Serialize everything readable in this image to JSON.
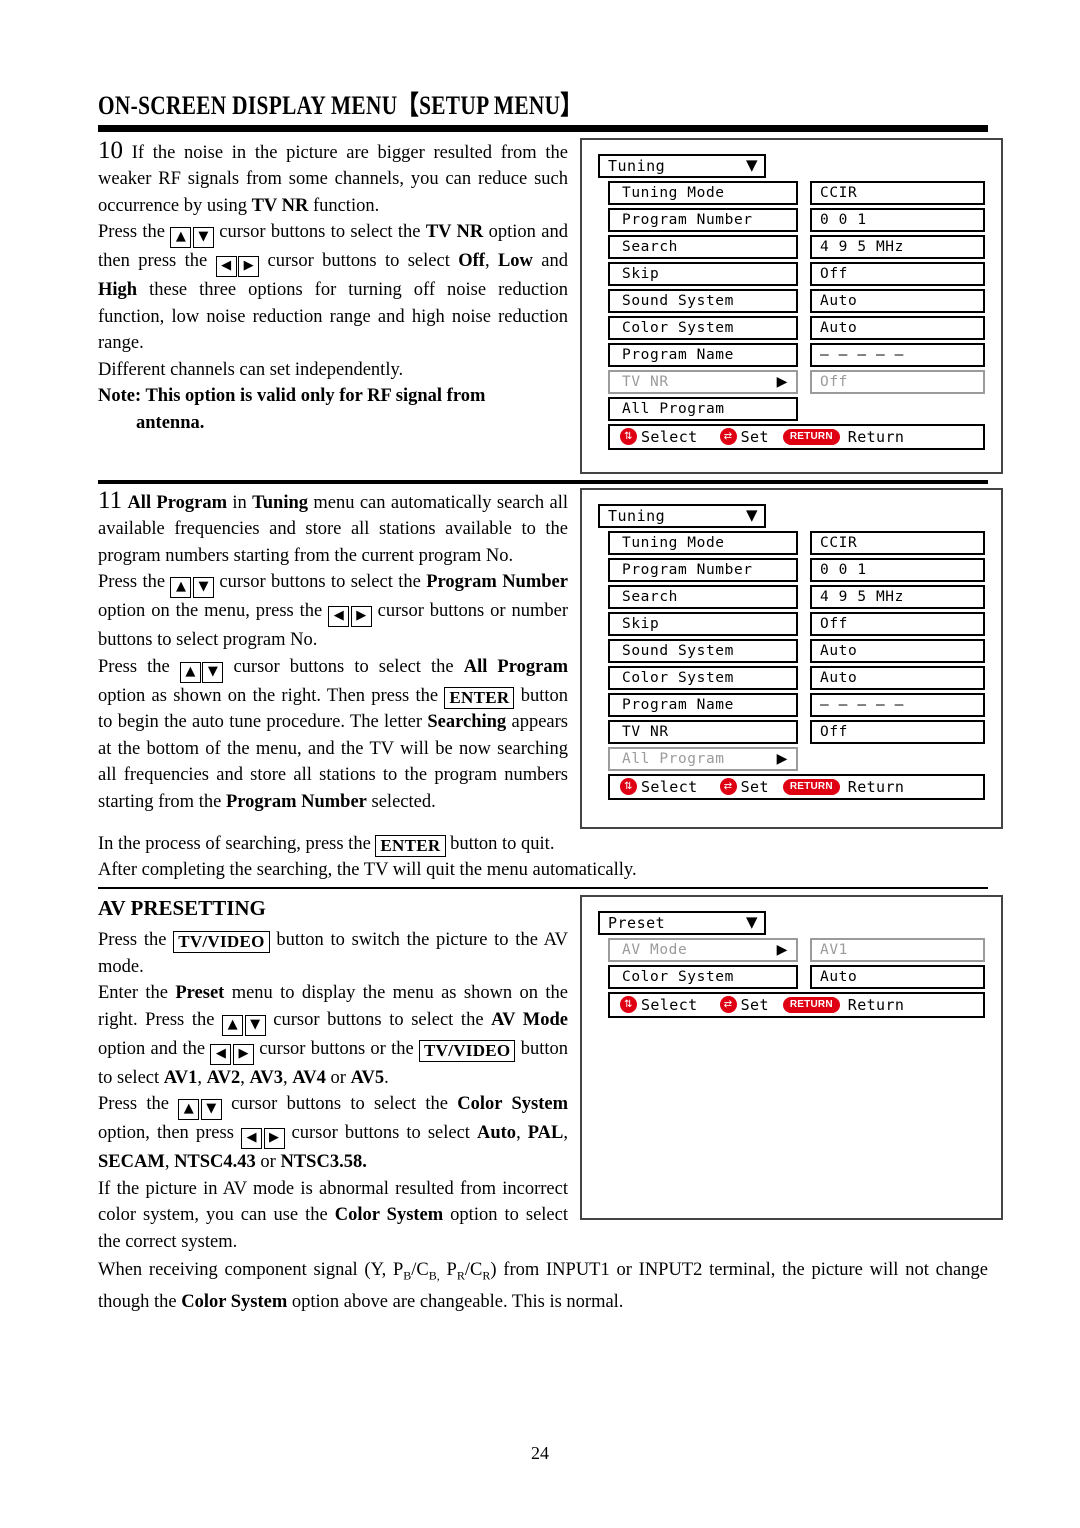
{
  "header": {
    "title": "ON-SCREEN DISPLAY MENU【SETUP MENU】"
  },
  "sections": {
    "item10": {
      "number": "10",
      "p1_a": "If the noise in the picture are bigger resulted from the weaker RF signals from some channels, you can reduce such occurrence by using ",
      "p1_b": "TV NR",
      "p1_c": " function.",
      "p2_a": "Press the ",
      "p2_b": " cursor buttons to select the ",
      "p2_c": "TV NR",
      "p2_d": " option and then press the ",
      "p2_e": " cursor buttons to select ",
      "p2_f": "Off",
      "p2_g": ", ",
      "p2_h": "Low",
      "p2_i": " and ",
      "p2_j": "High",
      "p2_k": " these three options for turning off noise reduction function, low noise reduction range and high noise reduction range.",
      "p3": "Different channels can set independently.",
      "note_label": "Note:",
      "note_body": " This option is valid only for RF signal from",
      "note_indent": "antenna."
    },
    "item11": {
      "number": "11",
      "p1_a": "All Program",
      "p1_b": " in ",
      "p1_c": "Tuning",
      "p1_d": " menu can automatically search all available frequencies and store all stations available to the program numbers starting from the current program No.",
      "p2_a": "Press the ",
      "p2_b": " cursor buttons to select the ",
      "p2_c": "Program Number",
      "p2_d": " option on the menu, press the ",
      "p2_e": " cursor buttons or number buttons to select program No.",
      "p3_a": "Press the ",
      "p3_b": " cursor buttons to select the ",
      "p3_c": "All Program",
      "p3_d": " option as shown on the right. Then press the ",
      "p3_e": "ENTER",
      "p3_f": " button to begin the auto tune procedure. The letter ",
      "p3_g": "Searching",
      "p3_h": " appears at the bottom of the menu, and the TV will be now searching all frequencies and store all stations to the program numbers starting from the ",
      "p3_i": "Program Number",
      "p3_j": " selected.",
      "p4_a": "In the process of searching, press the ",
      "p4_b": "ENTER",
      "p4_c": " button to quit.",
      "p5": "After completing the searching, the TV will quit the menu automatically."
    },
    "av": {
      "heading": "AV PRESETTING",
      "p1_a": "Press the ",
      "p1_b": "TV/VIDEO",
      "p1_c": " button to switch the picture to the AV mode.",
      "p2_a": "Enter the ",
      "p2_b": "Preset",
      "p2_c": " menu to display the menu as shown on the right. Press the ",
      "p2_d": " cursor buttons to select the ",
      "p2_e": "AV Mode",
      "p2_f": " option and the ",
      "p2_g": " cursor buttons or the ",
      "p2_h": "TV/VIDEO",
      "p2_i": " button to select ",
      "p2_j": "AV1",
      "p2_k": ", ",
      "p2_l": "AV2",
      "p2_m": "AV3",
      "p2_n": "AV4",
      "p2_o": " or ",
      "p2_p": "AV5",
      "p2_q": ".",
      "p3_a": "Press the ",
      "p3_b": " cursor buttons to select the ",
      "p3_c": "Color System",
      "p3_d": " option, then press ",
      "p3_e": " cursor buttons to select ",
      "p3_f": "Auto",
      "p3_g": ", ",
      "p3_h": "PAL",
      "p3_i": "SECAM",
      "p3_j": "NTSC4.43",
      "p3_k": " or ",
      "p3_l": "NTSC3.58.",
      "p4_a": "If the picture in AV mode is abnormal resulted from incorrect color system, you can use the ",
      "p4_b": "Color System",
      "p4_c": " option to select the correct system.",
      "p5_a": "When receiving component signal (Y, P",
      "p5_sub1": "B",
      "p5_b": "/C",
      "p5_sub2": "B,",
      "p5_c": " P",
      "p5_sub3": "R",
      "p5_d": "/C",
      "p5_sub4": "R",
      "p5_e": ") from INPUT1 or INPUT2 terminal, the picture will not change though the ",
      "p5_f": "Color System",
      "p5_g": " option above are changeable. This is normal."
    }
  },
  "osd_tuning_1": {
    "title": "Tuning",
    "title_arrow": "▼",
    "rows": [
      {
        "label": "Tuning Mode",
        "value": "CCIR",
        "dim": false,
        "arrow": ""
      },
      {
        "label": "Program Number",
        "value": "0 0 1",
        "dim": false,
        "arrow": ""
      },
      {
        "label": "Search",
        "value": "4 9 5 MHz",
        "dim": false,
        "arrow": ""
      },
      {
        "label": "Skip",
        "value": "Off",
        "dim": false,
        "arrow": ""
      },
      {
        "label": "Sound System",
        "value": "Auto",
        "dim": false,
        "arrow": ""
      },
      {
        "label": "Color System",
        "value": "Auto",
        "dim": false,
        "arrow": ""
      },
      {
        "label": "Program Name",
        "value": "– – – – –",
        "dim": false,
        "arrow": ""
      },
      {
        "label": "TV NR",
        "value": "Off",
        "dim": true,
        "arrow": "▶"
      },
      {
        "label": "All Program",
        "value": "",
        "dim": false,
        "arrow": ""
      }
    ],
    "footer": {
      "select": "Select",
      "set": "Set",
      "return_badge": "RETURN",
      "return": "Return"
    }
  },
  "osd_tuning_2": {
    "title": "Tuning",
    "title_arrow": "▼",
    "rows": [
      {
        "label": "Tuning Mode",
        "value": "CCIR",
        "dim": false,
        "arrow": ""
      },
      {
        "label": "Program Number",
        "value": "0 0 1",
        "dim": false,
        "arrow": ""
      },
      {
        "label": "Search",
        "value": "4 9 5 MHz",
        "dim": false,
        "arrow": ""
      },
      {
        "label": "Skip",
        "value": "Off",
        "dim": false,
        "arrow": ""
      },
      {
        "label": "Sound System",
        "value": "Auto",
        "dim": false,
        "arrow": ""
      },
      {
        "label": "Color System",
        "value": "Auto",
        "dim": false,
        "arrow": ""
      },
      {
        "label": "Program Name",
        "value": "– – – – –",
        "dim": false,
        "arrow": ""
      },
      {
        "label": "TV NR",
        "value": "Off",
        "dim": false,
        "arrow": ""
      },
      {
        "label": "All Program",
        "value": "",
        "dim": true,
        "arrow": "▶"
      }
    ],
    "footer": {
      "select": "Select",
      "set": "Set",
      "return_badge": "RETURN",
      "return": "Return"
    }
  },
  "osd_preset": {
    "title": "Preset",
    "title_arrow": "▼",
    "rows": [
      {
        "label": "AV Mode",
        "value": "AV1",
        "dim": true,
        "arrow": "▶"
      },
      {
        "label": "Color System",
        "value": "Auto",
        "dim": false,
        "arrow": ""
      }
    ],
    "footer": {
      "select": "Select",
      "set": "Set",
      "return_badge": "RETURN",
      "return": "Return"
    }
  },
  "footer": {
    "page_number": "24"
  },
  "colors": {
    "accent_red": "#e00014",
    "ink": "#000000",
    "dim_gray": "#9b9b9b"
  }
}
